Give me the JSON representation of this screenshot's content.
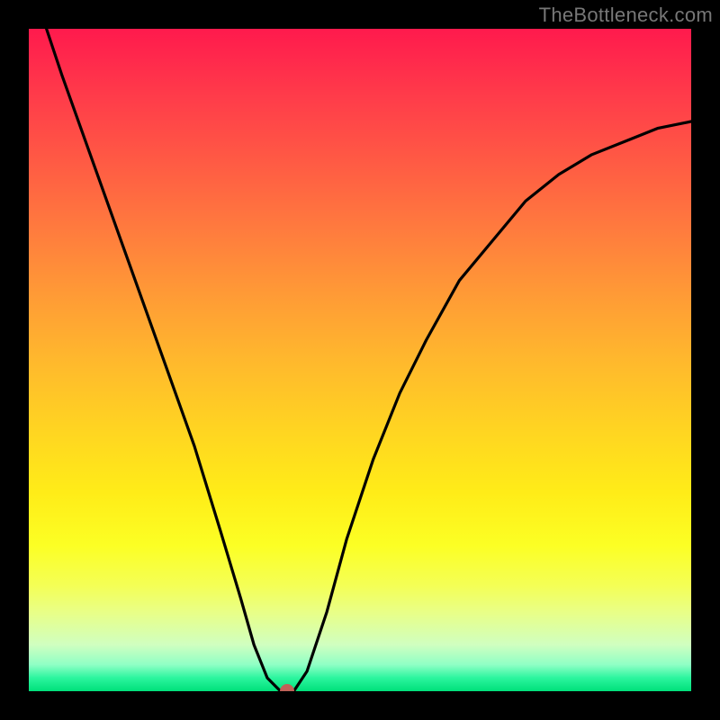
{
  "watermark": "TheBottleneck.com",
  "chart_data": {
    "type": "line",
    "title": "",
    "xlabel": "",
    "ylabel": "",
    "xlim": [
      0,
      1
    ],
    "ylim": [
      0,
      1
    ],
    "series": [
      {
        "name": "curve",
        "x": [
          0.0,
          0.05,
          0.1,
          0.15,
          0.2,
          0.25,
          0.29,
          0.32,
          0.34,
          0.36,
          0.38,
          0.4,
          0.42,
          0.45,
          0.48,
          0.52,
          0.56,
          0.6,
          0.65,
          0.7,
          0.75,
          0.8,
          0.85,
          0.9,
          0.95,
          1.0
        ],
        "y": [
          1.08,
          0.93,
          0.79,
          0.65,
          0.51,
          0.37,
          0.24,
          0.14,
          0.07,
          0.02,
          0.0,
          0.0,
          0.03,
          0.12,
          0.23,
          0.35,
          0.45,
          0.53,
          0.62,
          0.68,
          0.74,
          0.78,
          0.81,
          0.83,
          0.85,
          0.86
        ]
      }
    ],
    "marker": {
      "x": 0.39,
      "y": 0.0,
      "color": "#c06258"
    }
  }
}
